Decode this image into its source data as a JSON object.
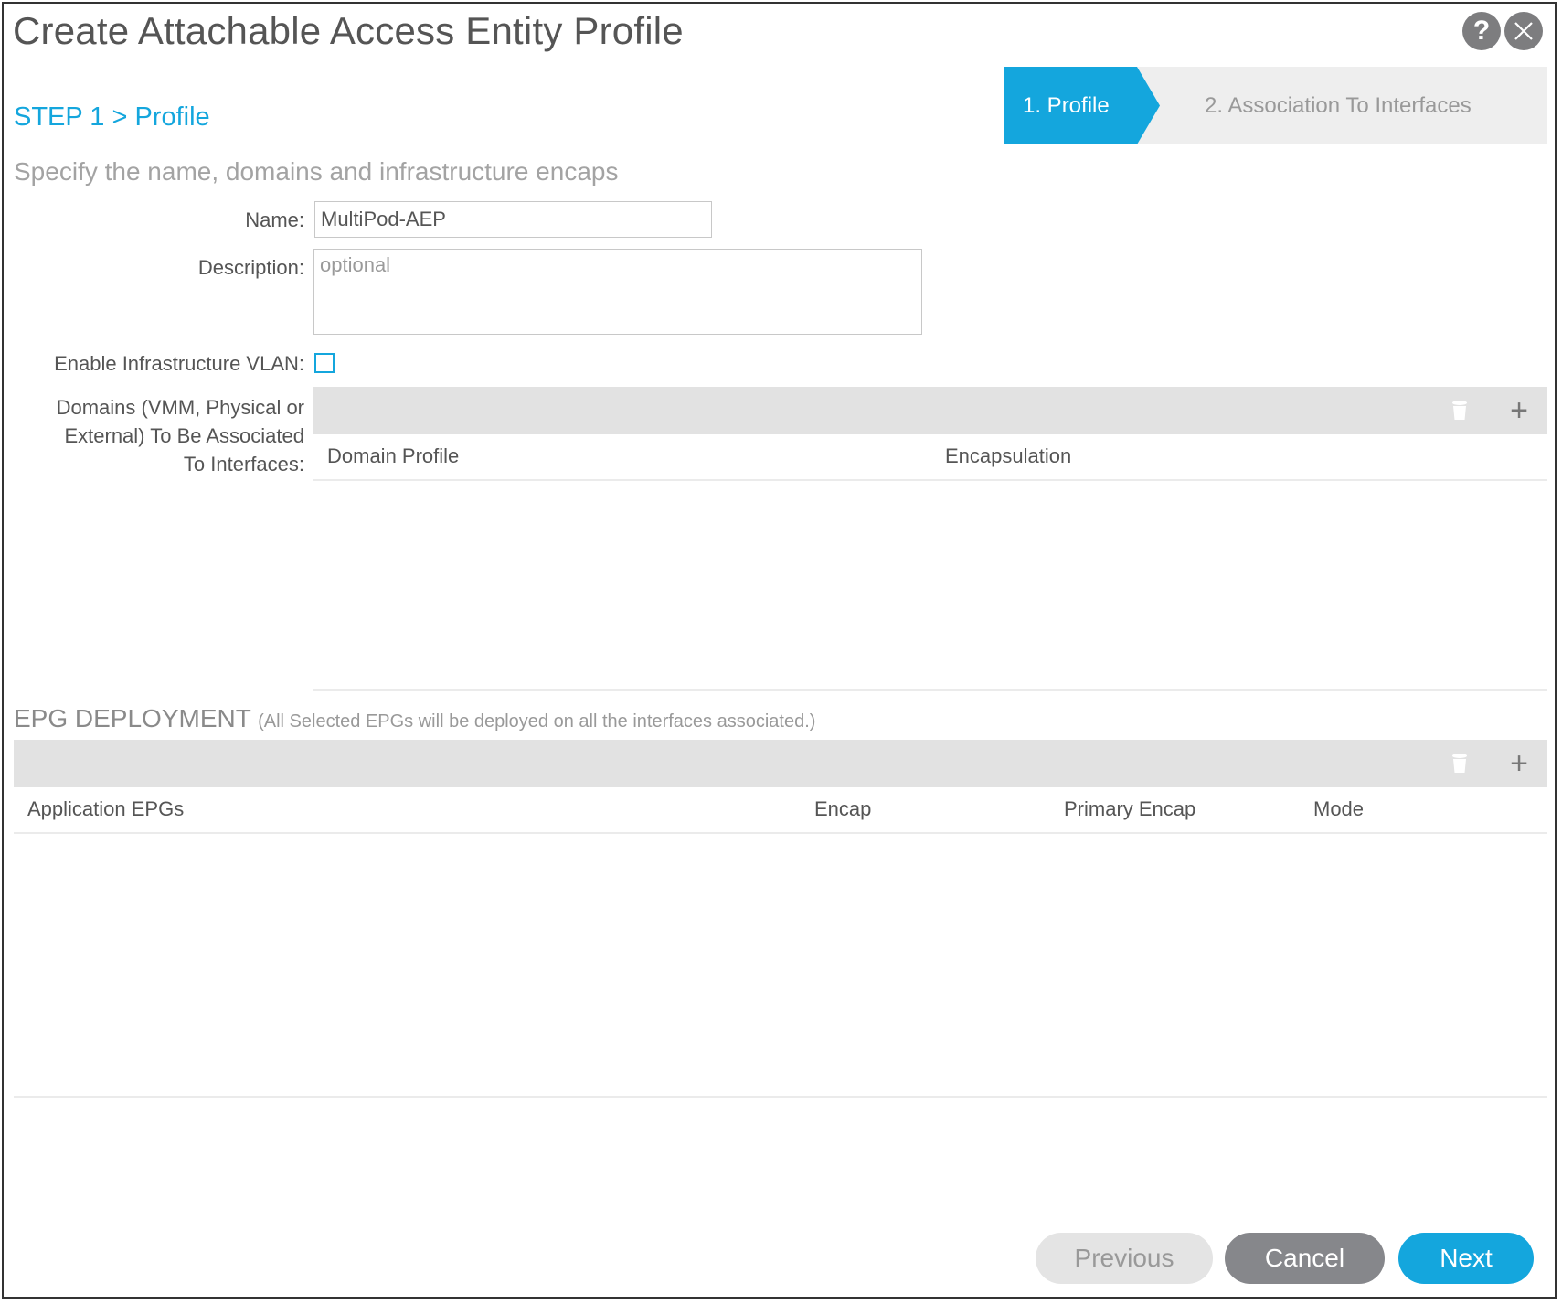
{
  "dialog": {
    "title": "Create Attachable Access Entity Profile",
    "help_icon": "question-circle-icon",
    "close_icon": "close-circle-icon"
  },
  "wizard": {
    "steps": [
      {
        "label": "1. Profile",
        "active": true
      },
      {
        "label": "2. Association To Interfaces",
        "active": false
      }
    ],
    "current_step_title": "STEP 1 > Profile",
    "subtitle": "Specify the name, domains and infrastructure encaps"
  },
  "form": {
    "name_label": "Name:",
    "name_value": "MultiPod-AEP",
    "description_label": "Description:",
    "description_value": "",
    "description_placeholder": "optional",
    "infra_vlan_label": "Enable Infrastructure VLAN:",
    "infra_vlan_checked": false,
    "domains_label_lines": [
      "Domains (VMM, Physical or",
      "External) To Be Associated",
      "To Interfaces:"
    ]
  },
  "domains_table": {
    "columns": [
      "Domain Profile",
      "Encapsulation"
    ],
    "rows": [],
    "toolbar": {
      "delete_icon": "trash-icon",
      "add_icon": "plus-icon",
      "add_label": "+"
    }
  },
  "epg_deployment": {
    "heading": "EPG DEPLOYMENT",
    "note": "(All Selected EPGs will be deployed on all the interfaces associated.)",
    "columns": [
      "Application EPGs",
      "Encap",
      "Primary Encap",
      "Mode"
    ],
    "rows": [],
    "toolbar": {
      "delete_icon": "trash-icon",
      "add_icon": "plus-icon",
      "add_label": "+"
    }
  },
  "footer": {
    "previous_label": "Previous",
    "cancel_label": "Cancel",
    "next_label": "Next"
  },
  "colors": {
    "accent": "#14a6dd",
    "cancel_button": "#86878b",
    "disabled_button": "#e4e4e4",
    "toolbar_bg": "#e2e2e2"
  }
}
